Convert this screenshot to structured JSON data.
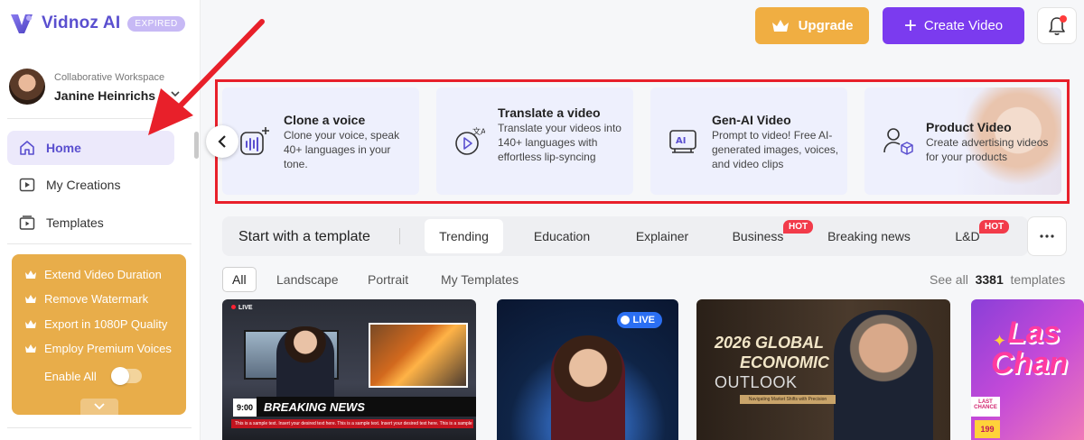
{
  "app": {
    "name": "Vidnoz AI",
    "plan_badge": "EXPIRED"
  },
  "workspace": {
    "label": "Collaborative Workspace",
    "user_name": "Janine Heinrichs"
  },
  "sidebar": {
    "items": [
      {
        "label": "Home",
        "icon": "home-icon",
        "active": true
      },
      {
        "label": "My Creations",
        "icon": "play-square-icon",
        "active": false
      },
      {
        "label": "Templates",
        "icon": "template-icon",
        "active": false
      }
    ],
    "promo": {
      "features": [
        "Extend Video Duration",
        "Remove Watermark",
        "Export in 1080P Quality",
        "Employ Premium Voices"
      ],
      "enable_all_label": "Enable All",
      "enable_all_on": false
    }
  },
  "header": {
    "upgrade_label": "Upgrade",
    "create_label": "Create Video"
  },
  "features": [
    {
      "title": "Clone a voice",
      "desc": "Clone your voice, speak 40+ languages in your tone.",
      "icon": "voice-clone-icon"
    },
    {
      "title": "Translate a video",
      "desc": "Translate your videos into 140+ languages with effortless lip-syncing",
      "icon": "translate-video-icon"
    },
    {
      "title": "Gen-AI Video",
      "desc": "Prompt to video! Free AI-generated images, voices, and video clips",
      "icon": "ai-video-icon"
    },
    {
      "title": "Product Video",
      "desc": "Create advertising videos for your products",
      "icon": "product-avatar-icon"
    }
  ],
  "templates": {
    "title": "Start with a template",
    "tabs": [
      {
        "label": "Trending",
        "active": true,
        "hot": false
      },
      {
        "label": "Education",
        "active": false,
        "hot": false
      },
      {
        "label": "Explainer",
        "active": false,
        "hot": false
      },
      {
        "label": "Business",
        "active": false,
        "hot": true
      },
      {
        "label": "Breaking news",
        "active": false,
        "hot": false
      },
      {
        "label": "L&D",
        "active": false,
        "hot": true
      }
    ],
    "hot_label": "HOT",
    "filters": [
      "All",
      "Landscape",
      "Portrait",
      "My Templates"
    ],
    "see_all_label": "See all",
    "count": "3381",
    "count_suffix": "templates"
  },
  "thumbnails": {
    "t1": {
      "live": "LIVE",
      "time": "9:00",
      "headline": "BREAKING NEWS",
      "ticker": "This is a sample text. Insert your desired text here. This is a sample text. Insert your desired text here. This is a sample text. Insert your desired text here."
    },
    "t2": {
      "live": "LIVE"
    },
    "t3": {
      "line1": "2026 GLOBAL",
      "line2": "ECONOMIC",
      "line3": "OUTLOOK",
      "sub": "Navigating Market Shifts with Precision"
    },
    "t4": {
      "line1": "Las",
      "line2": "Chan",
      "tag": "LAST CHANCE",
      "price": "199"
    }
  },
  "colors": {
    "brand": "#5a4fcf",
    "upgrade": "#f0ae42",
    "create": "#7b3bef",
    "highlight": "#e8202a",
    "hot": "#f23b4a"
  }
}
